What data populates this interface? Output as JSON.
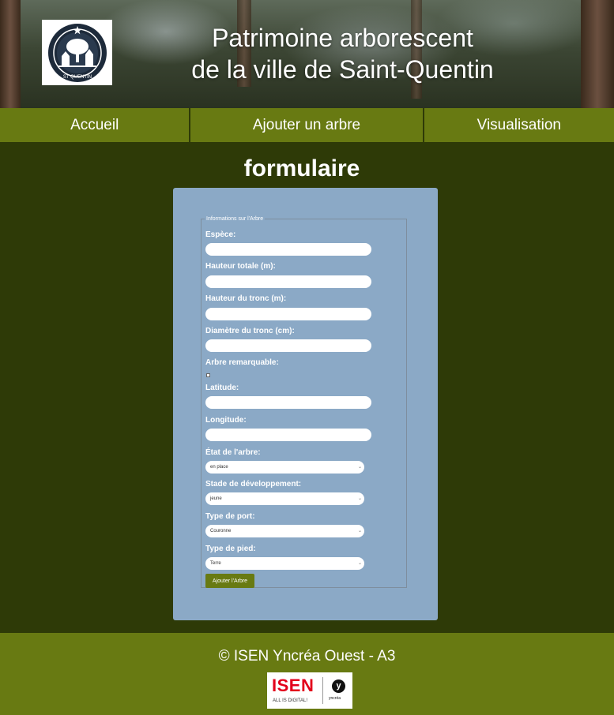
{
  "header": {
    "title_line1": "Patrimoine arborescent",
    "title_line2": "de la ville de Saint-Quentin",
    "logo_text": "ST QUENTIN",
    "logo_icon": "tree-emblem-icon"
  },
  "nav": {
    "items": [
      {
        "label": "Accueil"
      },
      {
        "label": "Ajouter un arbre"
      },
      {
        "label": "Visualisation"
      }
    ]
  },
  "page": {
    "title": "formulaire"
  },
  "form": {
    "legend": "Informations sur l'Arbre",
    "labels": {
      "espece": "Espèce:",
      "hauteur_totale": "Hauteur totale (m):",
      "hauteur_tronc": "Hauteur du tronc (m):",
      "diametre_tronc": "Diamètre du tronc (cm):",
      "remarquable": "Arbre remarquable:",
      "latitude": "Latitude:",
      "longitude": "Longitude:",
      "etat": "État de l'arbre:",
      "stade": "Stade de développement:",
      "port": "Type de port:",
      "pied": "Type de pied:"
    },
    "values": {
      "espece": "",
      "hauteur_totale": "",
      "hauteur_tronc": "",
      "diametre_tronc": "",
      "remarquable": false,
      "latitude": "",
      "longitude": "",
      "etat": "en place",
      "stade": "jeune",
      "port": "Couronne",
      "pied": "Terre"
    },
    "submit_label": "Ajouter l'Arbre"
  },
  "footer": {
    "copyright": "© ISEN Yncréa Ouest - A3",
    "logo_word": "ISEN",
    "logo_tagline": "ALL IS DIGITAL!",
    "partner_letter": "y",
    "partner_word": "yncréa"
  },
  "colors": {
    "nav_bg": "#687a12",
    "page_bg": "#2e3a07",
    "card_bg": "#8ba9c6",
    "isen_red": "#e3001b"
  }
}
